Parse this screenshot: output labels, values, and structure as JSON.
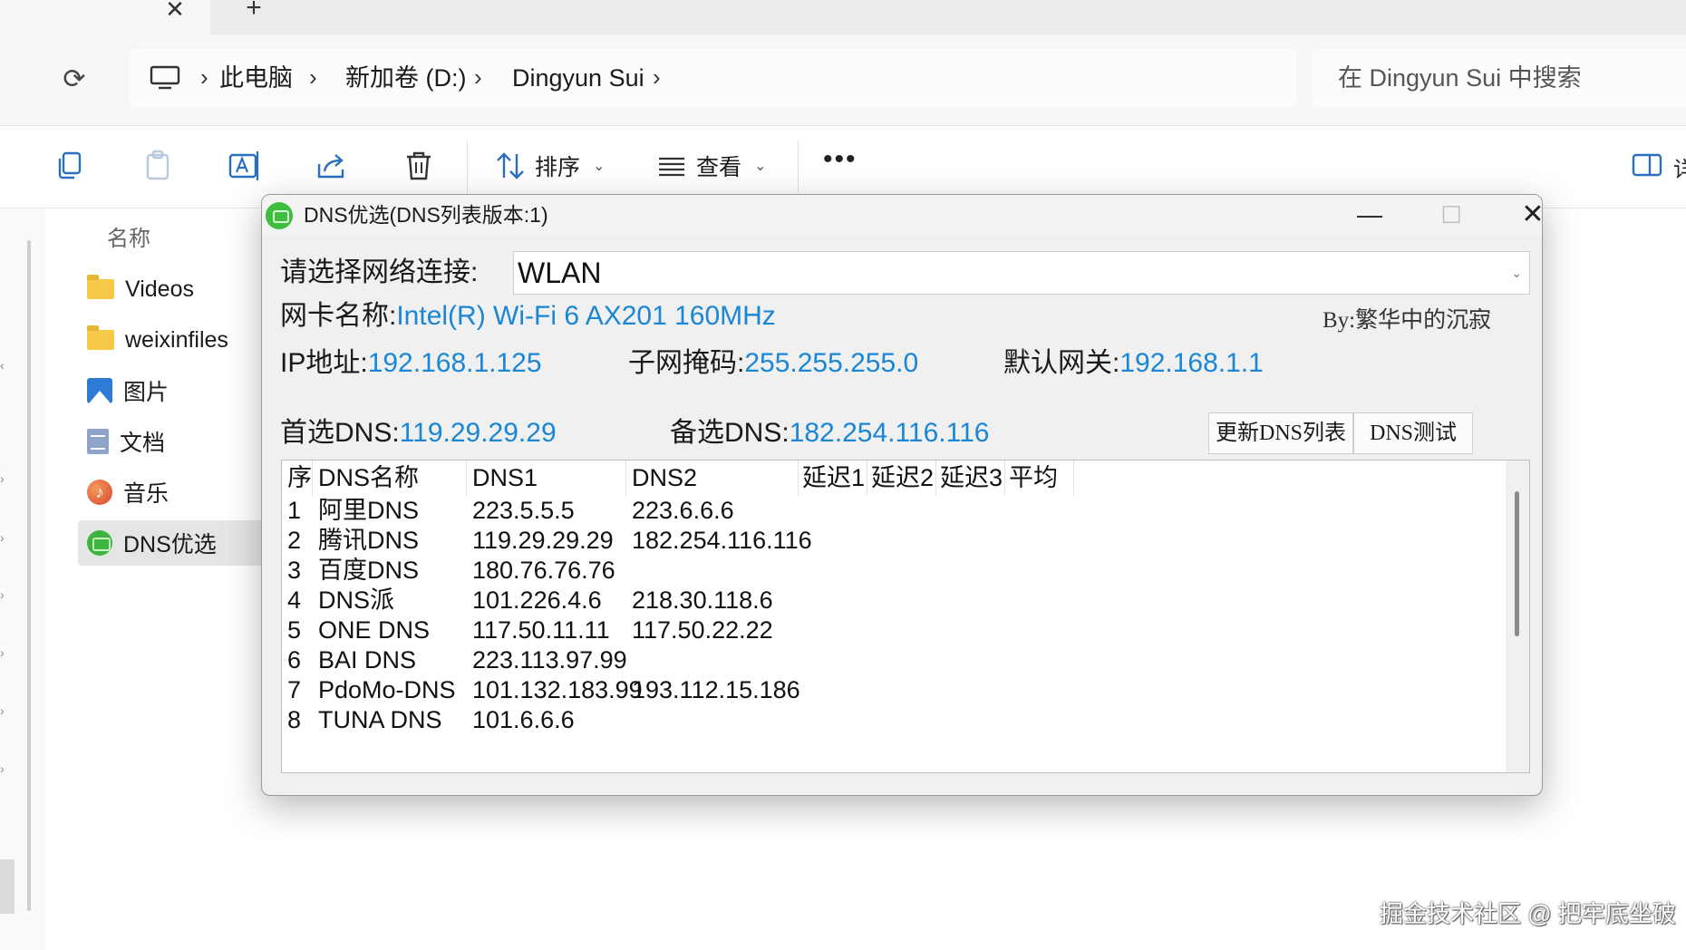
{
  "explorer": {
    "tab_close_glyph": "✕",
    "tab_new_glyph": "+",
    "breadcrumb": [
      "此电脑",
      "新加卷 (D:)",
      "Dingyun Sui"
    ],
    "search_placeholder": "在 Dingyun Sui 中搜索",
    "toolbar": {
      "sort_label": "排序",
      "view_label": "查看",
      "more_glyph": "•••",
      "details_label": "详"
    },
    "nav_header": "名称",
    "nav_items": [
      {
        "label": "Videos",
        "icon": "folder-icon"
      },
      {
        "label": "weixinfiles",
        "icon": "folder-icon"
      },
      {
        "label": "图片",
        "icon": "pictures-icon"
      },
      {
        "label": "文档",
        "icon": "documents-icon"
      },
      {
        "label": "音乐",
        "icon": "music-icon"
      },
      {
        "label": "DNS优选",
        "icon": "dns-app-icon",
        "selected": true
      }
    ]
  },
  "dialog": {
    "title": "DNS优选(DNS列表版本:1)",
    "network_label": "请选择网络连接:",
    "network_value": "WLAN",
    "nic_label": "网卡名称:",
    "nic_value": "Intel(R) Wi-Fi 6 AX201 160MHz",
    "author": "By:繁华中的沉寂",
    "ip_label": "IP地址:",
    "ip_value": "192.168.1.125",
    "mask_label": "子网掩码:",
    "mask_value": "255.255.255.0",
    "gateway_label": "默认网关:",
    "gateway_value": "192.168.1.1",
    "dns1_label": "首选DNS:",
    "dns1_value": "119.29.29.29",
    "dns2_label": "备选DNS:",
    "dns2_value": "182.254.116.116",
    "update_button": "更新DNS列表",
    "test_button": "DNS测试",
    "columns": [
      "序",
      "DNS名称",
      "DNS1",
      "DNS2",
      "延迟1",
      "延迟2",
      "延迟3",
      "平均"
    ],
    "rows": [
      [
        "1",
        "阿里DNS",
        "223.5.5.5",
        "223.6.6.6"
      ],
      [
        "2",
        "腾讯DNS",
        "119.29.29.29",
        "182.254.116.116"
      ],
      [
        "3",
        "百度DNS",
        "180.76.76.76",
        ""
      ],
      [
        "4",
        "DNS派",
        "101.226.4.6",
        "218.30.118.6"
      ],
      [
        "5",
        "ONE DNS",
        "117.50.11.11",
        "117.50.22.22"
      ],
      [
        "6",
        "BAI DNS",
        "223.113.97.99",
        ""
      ],
      [
        "7",
        "PdoMo-DNS",
        "101.132.183.99",
        "193.112.15.186"
      ],
      [
        "8",
        "TUNA DNS",
        "101.6.6.6",
        ""
      ]
    ]
  },
  "watermark": "掘金技术社区 @ 把牢底坐破",
  "colors": {
    "value_blue": "#1a86d6",
    "dialog_bg": "#f0f0f0",
    "folder_yellow": "#f7c948",
    "app_green": "#3db53d"
  }
}
